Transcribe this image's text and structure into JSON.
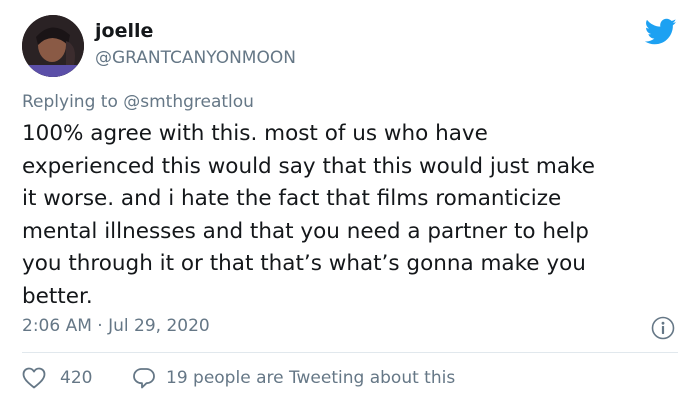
{
  "author": {
    "display_name": "joelle",
    "handle": "@GRANTCANYONMOON"
  },
  "reply": {
    "prefix": "Replying to ",
    "to_handle": "@smthgreatlou"
  },
  "tweet": {
    "text": "100% agree with this. most of us who have\nexperienced this would say that this would just make\nit worse. and i hate the fact that films romanticize\nmental illnesses and that you need a partner to help\nyou through it or that that’s what’s gonna make you\nbetter.",
    "timestamp": "2:06 AM · Jul 29, 2020"
  },
  "engagement": {
    "likes": "420",
    "tweeting_text": "19 people are Tweeting about this"
  },
  "colors": {
    "twitter_blue": "#1da1f2",
    "secondary_text": "#657786",
    "primary_text": "#14171a",
    "divider": "#e1e8ed"
  },
  "icons": {
    "logo": "twitter-bird-icon",
    "info": "info-icon",
    "like": "heart-icon",
    "reply": "speech-bubble-icon"
  }
}
